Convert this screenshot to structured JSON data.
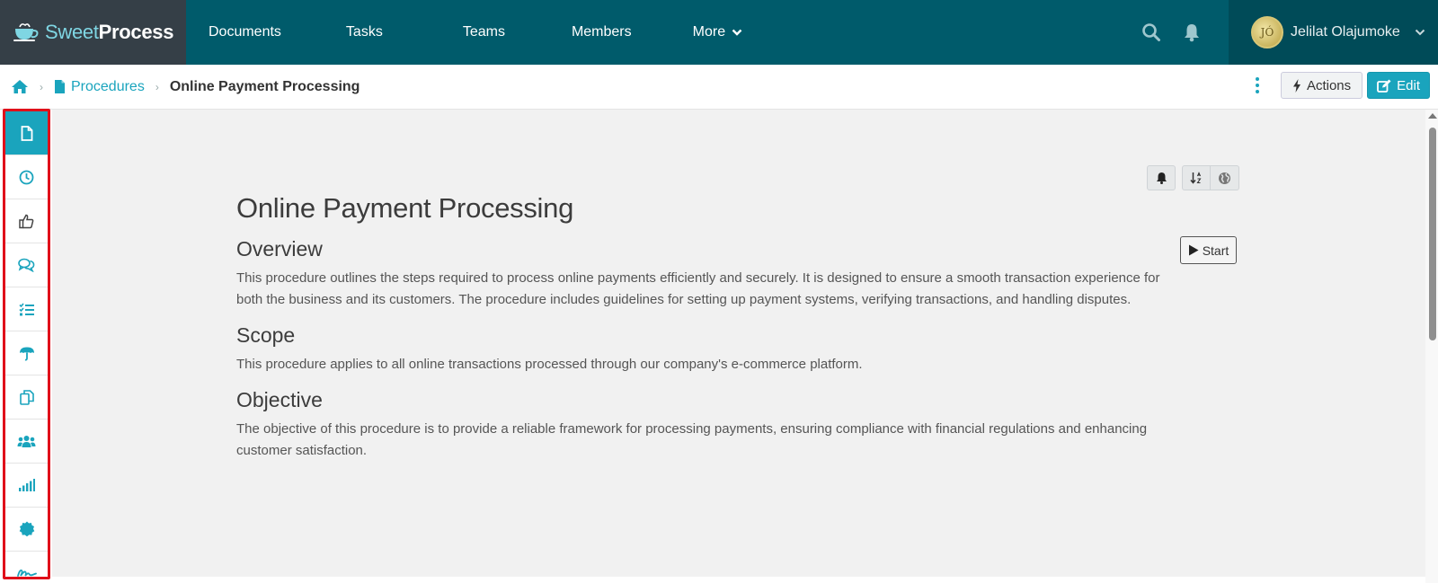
{
  "brand": {
    "light": "Sweet",
    "bold": "Process"
  },
  "nav": {
    "items": [
      {
        "label": "Documents"
      },
      {
        "label": "Tasks"
      },
      {
        "label": "Teams"
      },
      {
        "label": "Members"
      },
      {
        "label": "More"
      }
    ]
  },
  "user": {
    "name": "Jelilat Olajumoke",
    "avatar_text": "JÓ"
  },
  "breadcrumb": {
    "link": "Procedures",
    "current": "Online Payment Processing"
  },
  "toolbar": {
    "actions_label": "Actions",
    "edit_label": "Edit"
  },
  "sidebar": {
    "items": [
      {
        "icon": "document-icon",
        "active": true
      },
      {
        "icon": "clock-icon"
      },
      {
        "icon": "thumbs-up-icon"
      },
      {
        "icon": "comments-icon"
      },
      {
        "icon": "checklist-icon"
      },
      {
        "icon": "umbrella-icon"
      },
      {
        "icon": "copy-icon"
      },
      {
        "icon": "users-icon"
      },
      {
        "icon": "signal-bars-icon"
      },
      {
        "icon": "badge-icon"
      },
      {
        "icon": "signature-icon"
      }
    ]
  },
  "doc": {
    "start_label": "Start",
    "title": "Online Payment Processing",
    "sections": [
      {
        "heading": "Overview",
        "body": "This procedure outlines the steps required to process online payments efficiently and securely. It is designed to ensure a smooth transaction experience for both the business and its customers. The procedure includes guidelines for setting up payment systems, verifying transactions, and handling disputes."
      },
      {
        "heading": "Scope",
        "body": "This procedure applies to all online transactions processed through our company's e-commerce platform."
      },
      {
        "heading": "Objective",
        "body": "The objective of this procedure is to provide a reliable framework for processing payments, ensuring compliance with financial regulations and enhancing customer satisfaction."
      }
    ]
  },
  "colors": {
    "topbar": "#005b6b",
    "accent": "#1aa4bd",
    "logo_bg": "#353f47",
    "highlight_border": "#e0101a"
  }
}
